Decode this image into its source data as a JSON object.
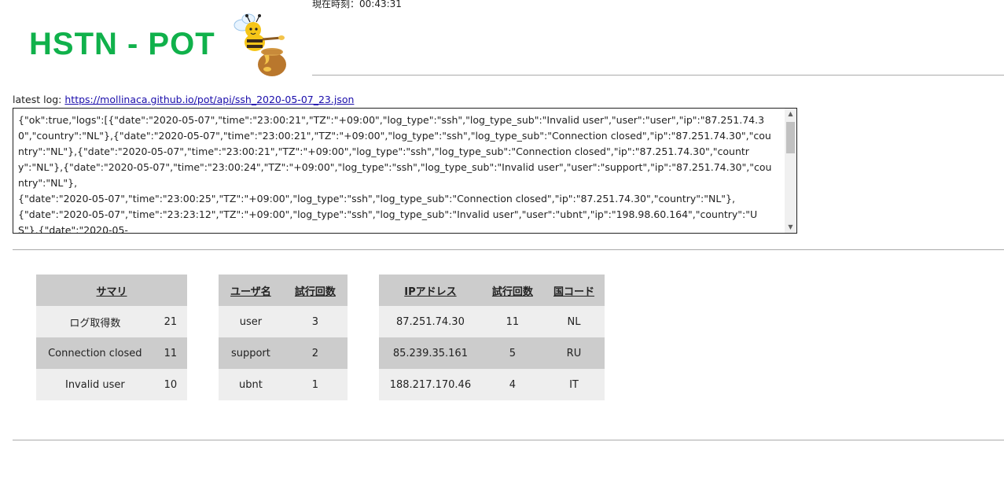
{
  "header": {
    "title": "HSTN - POT",
    "clock_text": "現在時刻：00:43:31"
  },
  "latest_log": {
    "label": "latest log:",
    "link_text": "https://mollinaca.github.io/pot/api/ssh_2020-05-07_23.json",
    "content": "{\"ok\":true,\"logs\":[{\"date\":\"2020-05-07\",\"time\":\"23:00:21\",\"TZ\":\"+09:00\",\"log_type\":\"ssh\",\"log_type_sub\":\"Invalid user\",\"user\":\"user\",\"ip\":\"87.251.74.30\",\"country\":\"NL\"},{\"date\":\"2020-05-07\",\"time\":\"23:00:21\",\"TZ\":\"+09:00\",\"log_type\":\"ssh\",\"log_type_sub\":\"Connection closed\",\"ip\":\"87.251.74.30\",\"country\":\"NL\"},{\"date\":\"2020-05-07\",\"time\":\"23:00:21\",\"TZ\":\"+09:00\",\"log_type\":\"ssh\",\"log_type_sub\":\"Connection closed\",\"ip\":\"87.251.74.30\",\"country\":\"NL\"},{\"date\":\"2020-05-07\",\"time\":\"23:00:24\",\"TZ\":\"+09:00\",\"log_type\":\"ssh\",\"log_type_sub\":\"Invalid user\",\"user\":\"support\",\"ip\":\"87.251.74.30\",\"country\":\"NL\"},\n{\"date\":\"2020-05-07\",\"time\":\"23:00:25\",\"TZ\":\"+09:00\",\"log_type\":\"ssh\",\"log_type_sub\":\"Connection closed\",\"ip\":\"87.251.74.30\",\"country\":\"NL\"},\n{\"date\":\"2020-05-07\",\"time\":\"23:23:12\",\"TZ\":\"+09:00\",\"log_type\":\"ssh\",\"log_type_sub\":\"Invalid user\",\"user\":\"ubnt\",\"ip\":\"198.98.60.164\",\"country\":\"US\"},{\"date\":\"2020-05-"
  },
  "summary_table": {
    "header": "サマリ",
    "rows": [
      {
        "label": "ログ取得数",
        "value": "21"
      },
      {
        "label": "Connection closed",
        "value": "11"
      },
      {
        "label": "Invalid user",
        "value": "10"
      }
    ]
  },
  "user_table": {
    "headers": [
      "ユーザ名",
      "試行回数"
    ],
    "rows": [
      {
        "user": "user",
        "count": "3"
      },
      {
        "user": "support",
        "count": "2"
      },
      {
        "user": "ubnt",
        "count": "1"
      }
    ]
  },
  "ip_table": {
    "headers": [
      "IPアドレス",
      "試行回数",
      "国コード"
    ],
    "rows": [
      {
        "ip": "87.251.74.30",
        "count": "11",
        "country": "NL"
      },
      {
        "ip": "85.239.35.161",
        "count": "5",
        "country": "RU"
      },
      {
        "ip": "188.217.170.46",
        "count": "4",
        "country": "IT"
      }
    ]
  },
  "colors": {
    "title_green": "#10b14b",
    "link_blue": "#1a0dab",
    "table_dark": "#cccccc",
    "table_light": "#eeeeee"
  },
  "icons": {
    "logo": "bee-honey-pot-icon"
  }
}
